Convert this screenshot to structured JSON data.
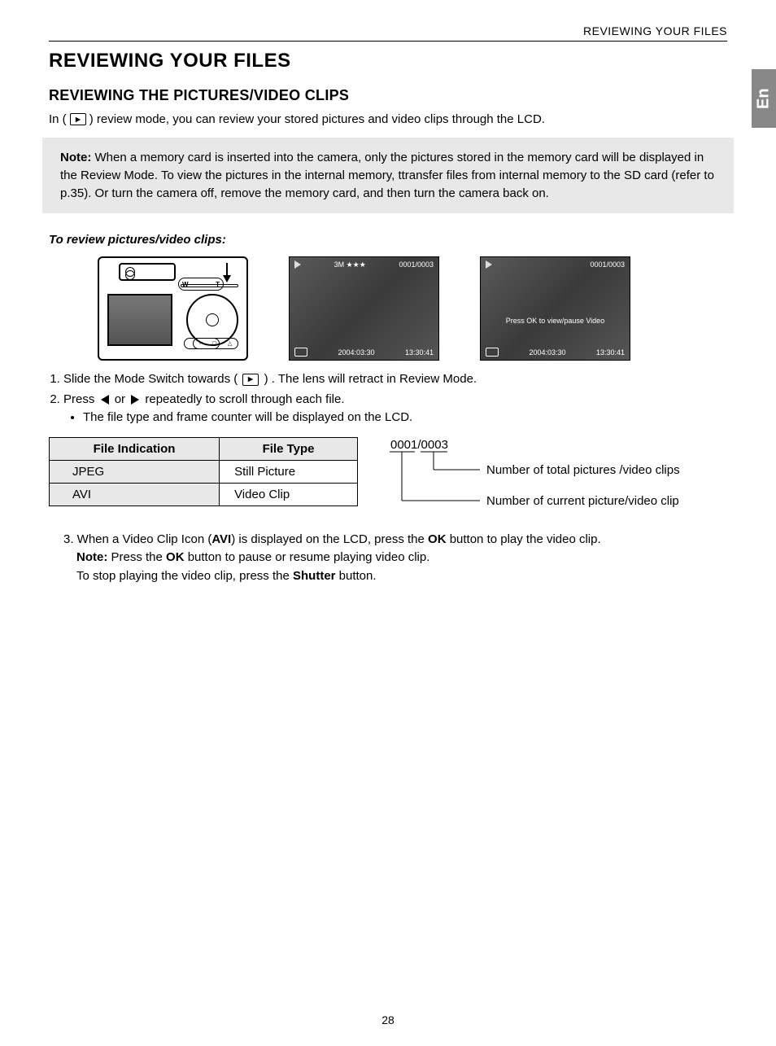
{
  "header": {
    "running": "REVIEWING YOUR FILES",
    "lang_tab": "En"
  },
  "title": "REVIEWING YOUR FILES",
  "section_title": "REVIEWING THE PICTURES/VIDEO CLIPS",
  "intro": {
    "pre": "In (",
    "post": ") review mode, you can review your stored pictures and video clips through the LCD."
  },
  "note": {
    "label": "Note:",
    "text": " When a memory card is inserted into the camera, only the pictures stored in the memory card will be displayed in the Review Mode. To view the pictures in the internal memory, ttransfer files from internal memory to the SD card (refer to p.35). Or turn the camera off, remove the memory card, and then turn the camera back on."
  },
  "subhead": "To review pictures/video clips:",
  "lcd1": {
    "quality": "3M ★★★",
    "counter": "0001/0003",
    "date": "2004:03:30",
    "time": "13:30:41"
  },
  "lcd2": {
    "counter": "0001/0003",
    "mid": "Press OK to view/pause Video",
    "date": "2004:03:30",
    "time": "13:30:41"
  },
  "steps": {
    "s1a": "Slide the Mode Switch towards (",
    "s1b": ") . The lens will retract in Review Mode.",
    "s2a": "Press ",
    "s2b": " or ",
    "s2c": " repeatedly to scroll through each file.",
    "s2_bullet": "The file type and frame counter will be displayed on the LCD."
  },
  "table": {
    "h1": "File Indication",
    "h2": "File Type",
    "r1c1": "JPEG",
    "r1c2": "Still Picture",
    "r2c1": "AVI",
    "r2c2": "Video Clip"
  },
  "callout": {
    "frac": "0001/0003",
    "label_total": "Number of total pictures /video clips",
    "label_current": "Number of current picture/video clip"
  },
  "step3": {
    "pre": "3.  When a Video Clip Icon (",
    "avi": "AVI",
    "mid1": ") is displayed on the LCD, press the ",
    "ok": "OK",
    "mid2": " button to play the video clip.",
    "line2a": "Note:",
    "line2b": " Press the ",
    "line2c": " button to pause or resume playing video clip.",
    "line3a": "To stop playing the video clip, press the ",
    "shutter": "Shutter",
    "line3b": " button."
  },
  "page_number": "28",
  "cam": {
    "w": "W",
    "t": "T"
  }
}
